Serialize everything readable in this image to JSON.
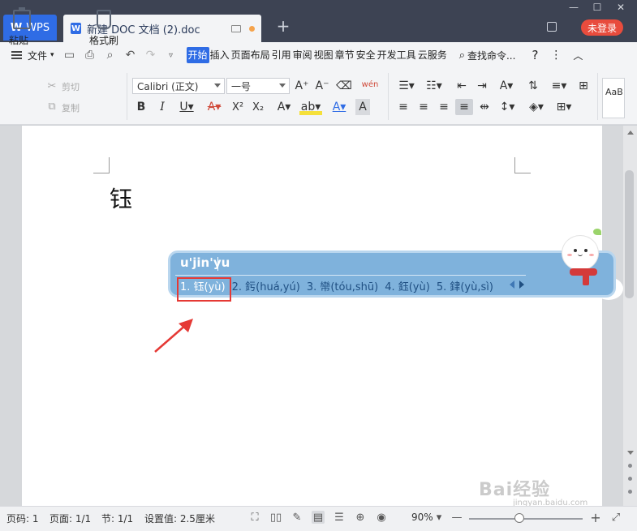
{
  "titlebar": {
    "app_tab": "WPS",
    "doc_tab": "新建 DOC 文档 (2).doc",
    "new_tab": "+",
    "login": "未登录",
    "minimize": "—",
    "maximize": "☐",
    "close": "✕"
  },
  "menubar": {
    "file": "文件",
    "items": [
      "开始",
      "插入",
      "页面布局",
      "引用",
      "审阅",
      "视图",
      "章节",
      "安全",
      "开发工具",
      "云服务"
    ],
    "search": "查找命令..."
  },
  "ribbon": {
    "paste": "粘贴",
    "cut": "剪切",
    "copy": "复制",
    "format_painter": "格式刷",
    "font_name": "Calibri (正文)",
    "font_size": "一号",
    "phonetic_label": "wén",
    "style_preview": "AaB"
  },
  "document": {
    "typed_text": "钰"
  },
  "ime": {
    "input": "u'jin'yu",
    "candidates": [
      "1. 钰(yù)",
      "2. 釫(huá,yú)",
      "3. 㡩(tóu,shū)",
      "4. 鈺(yù)",
      "5. 銉(yù,sì)"
    ]
  },
  "watermark": {
    "text": "Bai经验",
    "sub": "jingyan.baidu.com"
  },
  "statusbar": {
    "page_no": "页码: 1",
    "pages": "页面: 1/1",
    "section": "节: 1/1",
    "setting": "设置值: 2.5厘米",
    "zoom": "90%"
  },
  "colors": {
    "titlebar_bg": "#3d4353",
    "accent": "#2f6ce5",
    "login_bg": "#e84c3d",
    "ime_bg": "#7fb2dc",
    "highlight": "#e53935"
  },
  "zoom_level": 0.9
}
